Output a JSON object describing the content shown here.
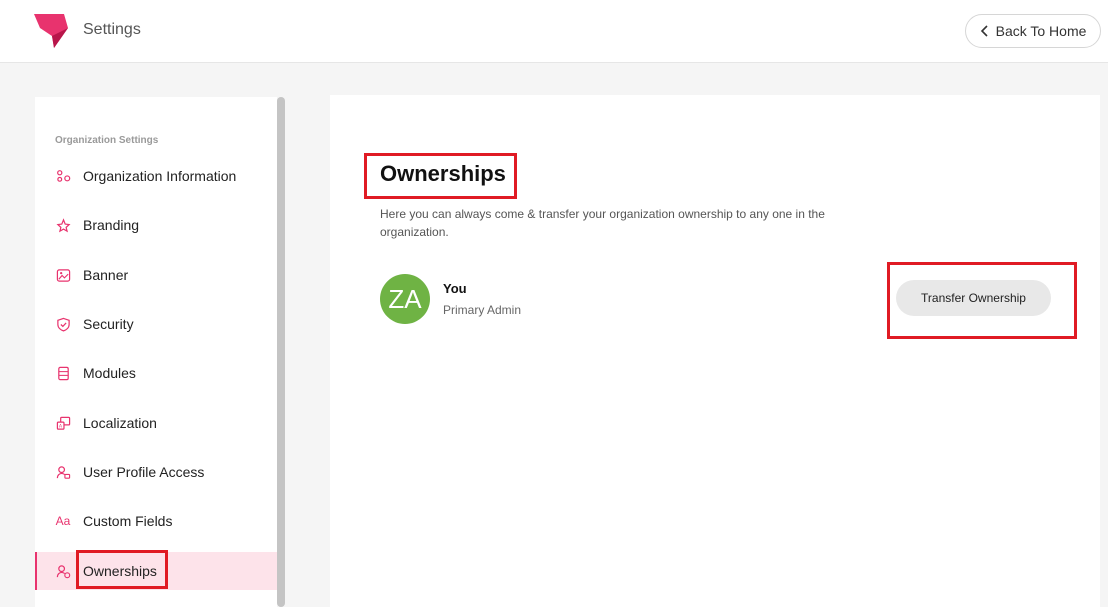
{
  "header": {
    "title": "Settings",
    "back_label": "Back To Home",
    "logo_icon": "brand-logo",
    "brand_color": "#e8336e"
  },
  "sidebar": {
    "heading": "Organization Settings",
    "items": [
      {
        "label": "Organization Information",
        "icon": "org-info-icon"
      },
      {
        "label": "Branding",
        "icon": "branding-icon"
      },
      {
        "label": "Banner",
        "icon": "banner-icon"
      },
      {
        "label": "Security",
        "icon": "shield-icon"
      },
      {
        "label": "Modules",
        "icon": "modules-icon"
      },
      {
        "label": "Localization",
        "icon": "localization-icon"
      },
      {
        "label": "User Profile Access",
        "icon": "user-profile-icon"
      },
      {
        "label": "Custom Fields",
        "icon": "custom-fields-icon",
        "glyph": "Aa"
      },
      {
        "label": "Ownerships",
        "icon": "ownership-icon",
        "active": true
      }
    ]
  },
  "main": {
    "title": "Ownerships",
    "description": "Here you can always come & transfer your organization ownership to any one in the organization.",
    "owner": {
      "initials": "ZA",
      "name": "You",
      "role": "Primary Admin",
      "avatar_color": "#6fb344"
    },
    "transfer_label": "Transfer Ownership"
  },
  "highlight_color": "#e01b24"
}
